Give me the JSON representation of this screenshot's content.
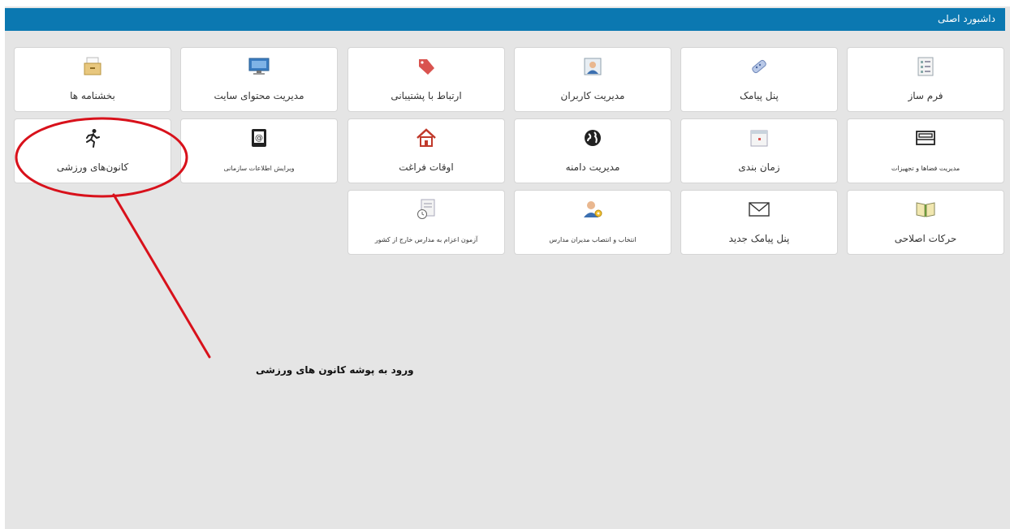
{
  "header": {
    "title": "داشبورد اصلی"
  },
  "tiles": [
    {
      "id": "form-builder",
      "label": "فرم ساز",
      "icon": "form-list-icon"
    },
    {
      "id": "sms-panel",
      "label": "پنل پیامک",
      "icon": "pill-icon"
    },
    {
      "id": "user-management",
      "label": "مدیریت کاربران",
      "icon": "user-card-icon"
    },
    {
      "id": "support",
      "label": "ارتباط با پشتیبانی",
      "icon": "tag-icon"
    },
    {
      "id": "site-content",
      "label": "مدیریت محتوای سایت",
      "icon": "monitor-icon"
    },
    {
      "id": "circulars",
      "label": "بخشنامه ها",
      "icon": "archive-drawer-icon"
    },
    {
      "id": "spaces-equipment",
      "label": "مدیریت فضاها و تجهیزات",
      "icon": "bed-icon"
    },
    {
      "id": "scheduling",
      "label": "زمان بندی",
      "icon": "calendar-icon"
    },
    {
      "id": "domain-management",
      "label": "مدیریت دامنه",
      "icon": "globe-icon"
    },
    {
      "id": "leisure-time",
      "label": "اوقات فراغت",
      "icon": "home-icon"
    },
    {
      "id": "org-info",
      "label": "ویرایش اطلاعات سازمانی",
      "icon": "address-book-icon"
    },
    {
      "id": "sports-clubs",
      "label": "کانون‌های ورزشی",
      "icon": "running-person-icon"
    },
    {
      "id": "corrective-actions",
      "label": "حرکات اصلاحی",
      "icon": "open-book-icon"
    },
    {
      "id": "new-sms-panel",
      "label": "پنل پیامک جدید",
      "icon": "envelope-icon"
    },
    {
      "id": "manager-appointment",
      "label": "انتخاب و انتصاب مدیران مدارس",
      "icon": "user-gear-icon"
    },
    {
      "id": "abroad-exam",
      "label": "آزمون اعزام به مدارس خارج از کشور",
      "icon": "clock-document-icon"
    }
  ],
  "annotation": {
    "text": "ورود به پوشه کانون های ورزشی"
  },
  "colors": {
    "header": "#0b78b1",
    "annotation": "#d8111b",
    "background": "#e5e5e5"
  }
}
